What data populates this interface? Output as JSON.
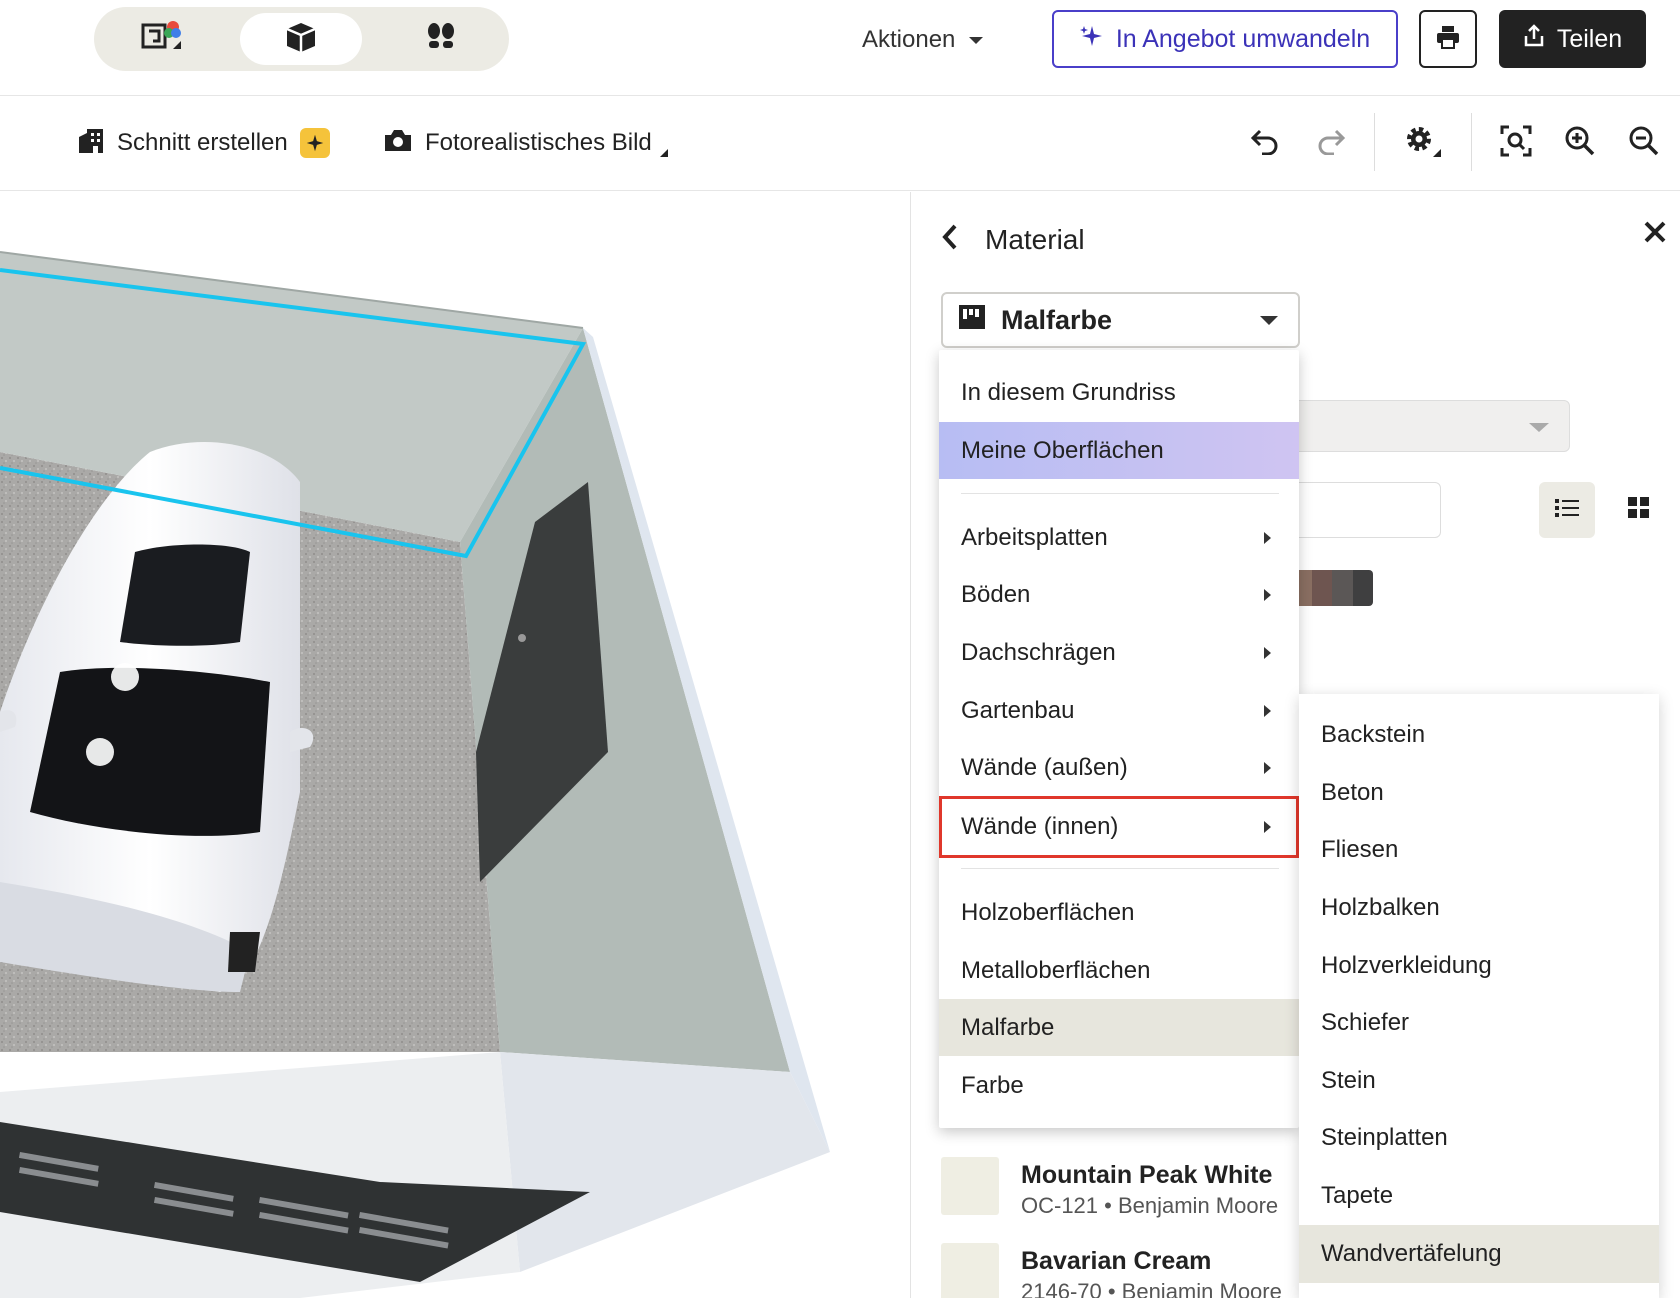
{
  "topbar": {
    "view_modes": [
      {
        "name": "2d-plan-icon",
        "active": false
      },
      {
        "name": "3d-box-icon",
        "active": true
      },
      {
        "name": "footsteps-icon",
        "active": false
      }
    ],
    "actions_label": "Aktionen",
    "convert_label": "In Angebot umwandeln",
    "print_icon": "printer-icon",
    "share_label": "Teilen"
  },
  "toolbar": {
    "section_label": "Schnitt erstellen",
    "photo_label": "Fotorealistisches Bild",
    "icons": [
      "undo-icon",
      "redo-icon",
      "settings-icon",
      "zoom-fit-icon",
      "zoom-in-icon",
      "zoom-out-icon"
    ]
  },
  "panel": {
    "title": "Material",
    "selected_category": "Malfarbe",
    "items": [
      {
        "name": "Mountain Peak White",
        "sub": "OC-121 • Benjamin Moore"
      },
      {
        "name": "Bavarian Cream",
        "sub": "2146-70 • Benjamin Moore"
      }
    ]
  },
  "menu": {
    "top_items": [
      "In diesem Grundriss",
      "Meine Oberflächen"
    ],
    "sub_items": [
      "Arbeitsplatten",
      "Böden",
      "Dachschrägen",
      "Gartenbau",
      "Wände (außen)",
      "Wände (innen)"
    ],
    "bottom_items": [
      "Holzoberflächen",
      "Metalloberflächen",
      "Malfarbe",
      "Farbe"
    ],
    "highlighted": "Meine Oberflächen",
    "selected": "Malfarbe",
    "open_submenu": "Wände (innen)"
  },
  "submenu": {
    "items": [
      "Backstein",
      "Beton",
      "Fliesen",
      "Holzbalken",
      "Holzverkleidung",
      "Schiefer",
      "Stein",
      "Steinplatten",
      "Tapete",
      "Wandvertäfelung"
    ],
    "hovered": "Wandvertäfelung"
  },
  "colors": {
    "accent": "#3b32b8",
    "highlight_outline": "#e0372b",
    "wall_outline": "#19c4ee"
  }
}
